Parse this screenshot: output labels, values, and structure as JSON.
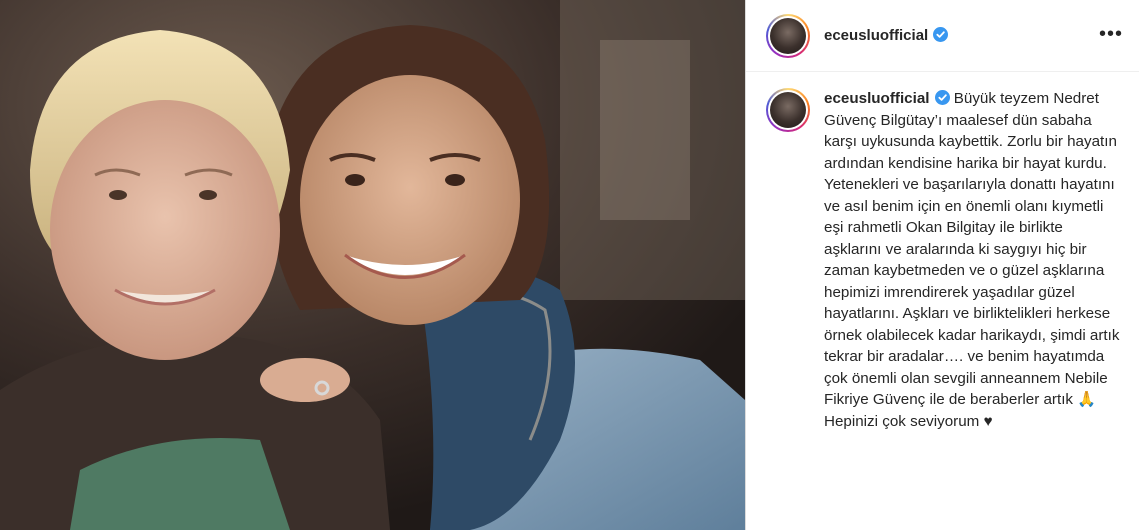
{
  "post": {
    "username": "eceusluofficial",
    "verified": true,
    "more_icon": "more-options-icon",
    "caption": "Büyük teyzem Nedret Güvenç Bilgütay’ı maalesef dün sabaha karşı uykusunda kaybettik. Zorlu bir hayatın ardından kendisine harika bir hayat kurdu. Yetenekleri ve başarılarıyla donattı hayatını ve asıl benim için en önemli olanı kıymetli eşi rahmetli Okan Bilgitay ile birlikte aşklarını ve aralarında ki saygıyı hiç bir zaman kaybetmeden ve o güzel aşklarına hepimizi imrendirerek yaşadılar güzel hayatlarını. Aşkları ve birliktelikleri herkese örnek olabilecek kadar harikaydı, şimdi artık tekrar bir aradalar…. ve benim hayatımda çok önemli olan sevgili anneannem Nebile Fikriye Güvenç ile de beraberler artık 🙏 Hepinizi çok seviyorum ♥"
  },
  "colors": {
    "verified_badge": "#3897f0",
    "text": "#262626",
    "border": "#dbdbdb"
  }
}
